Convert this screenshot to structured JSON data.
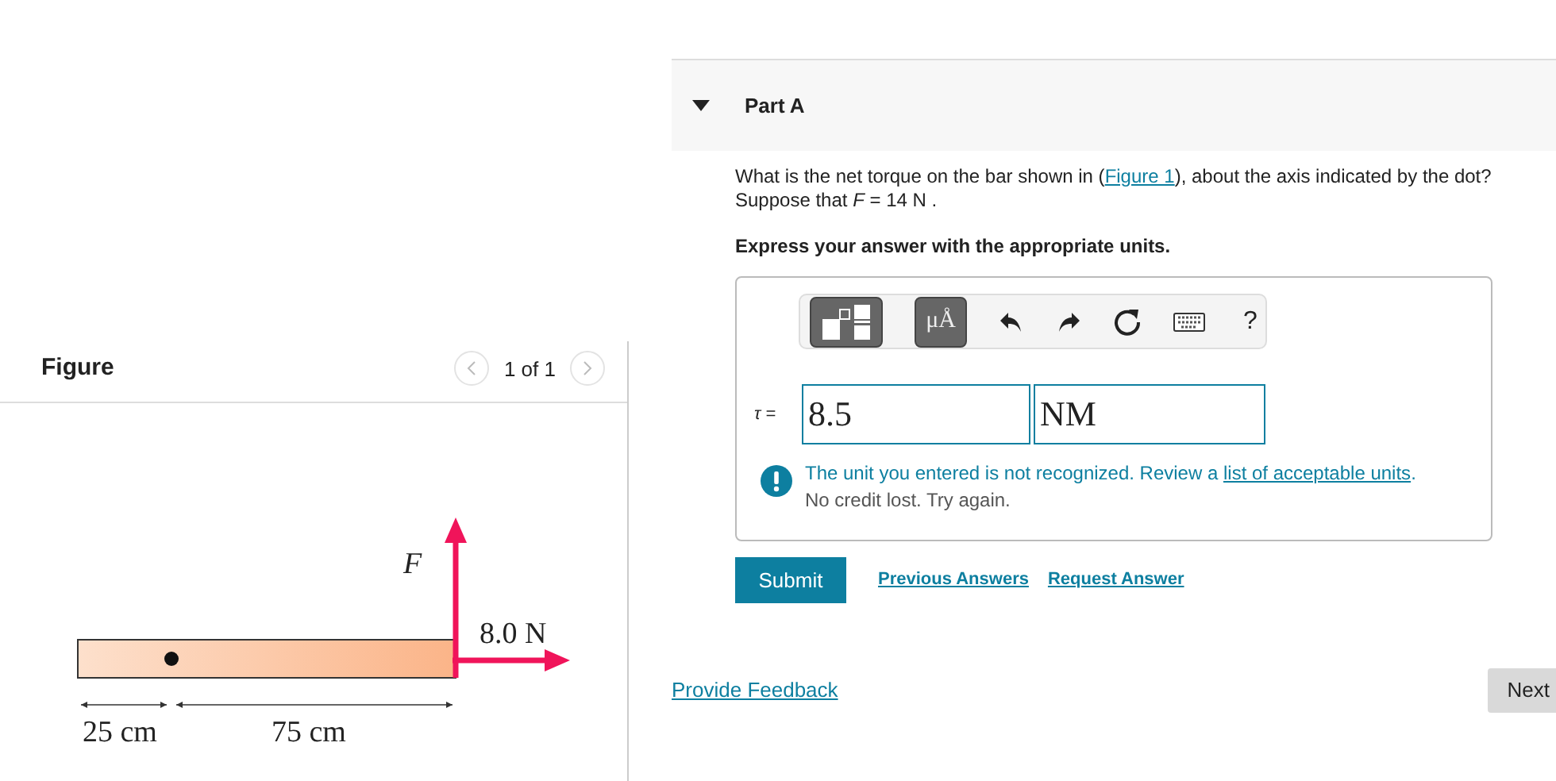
{
  "figure_panel": {
    "title": "Figure",
    "pager": "1 of 1",
    "prev_disabled": true,
    "next_disabled": true,
    "diagram": {
      "force_label": "F",
      "force2_label": "8.0 N",
      "left_length": "25 cm",
      "right_length": "75 cm"
    }
  },
  "part": {
    "title": "Part A",
    "expanded": true,
    "question": "What is the net torque on the bar shown in (",
    "question_link": "Figure 1",
    "question_rest": "), about the axis indicated by the dot?",
    "given": "Suppose that *F* = 14  N .",
    "instruction": "Express your answer with the appropriate units.",
    "toolbar": [
      {
        "kind": "templates"
      },
      {
        "kind": "units",
        "label": "μÅ"
      },
      {
        "kind": "undo"
      },
      {
        "kind": "redo"
      },
      {
        "kind": "reset"
      },
      {
        "kind": "keyboard"
      },
      {
        "kind": "help",
        "label": "?"
      }
    ],
    "variable": "τ =",
    "value": "8.5",
    "unit": "NM",
    "feedback": "The unit you entered is not recognized. Review a ",
    "feedback_link": "list of acceptable units",
    "feedback_end": ".",
    "feedback_note": "No credit lost. Try again.",
    "submit": "Submit",
    "links": [
      "Previous Answers",
      "Request Answer"
    ]
  },
  "provide_feedback": "Provide Feedback",
  "next": "Next"
}
